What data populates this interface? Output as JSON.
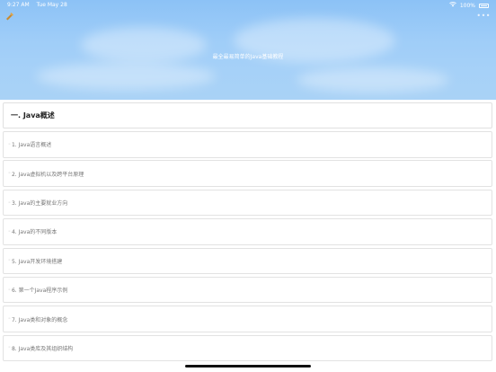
{
  "status_bar": {
    "time": "9:27 AM",
    "date": "Tue May 28",
    "battery_pct": "100%"
  },
  "header": {
    "title": "最全最易简单的Java基础教程",
    "more": "•••"
  },
  "section": {
    "title": "一. Java概述"
  },
  "items": [
    {
      "label": "1. Java语言概述"
    },
    {
      "label": "2. Java虚拟机以及跨平台原理"
    },
    {
      "label": "3. Java的主要就业方向"
    },
    {
      "label": "4. Java的不同版本"
    },
    {
      "label": "5. Java开发环境搭建"
    },
    {
      "label": "6. 第一个Java程序示例"
    },
    {
      "label": "7. Java类和对象的概念"
    },
    {
      "label": "8. Java类库及其组织结构"
    }
  ],
  "colors": {
    "header_top": "#8cc2f6",
    "header_bottom": "#a9d2f6",
    "bookmark_icon": "#c98a2f"
  }
}
